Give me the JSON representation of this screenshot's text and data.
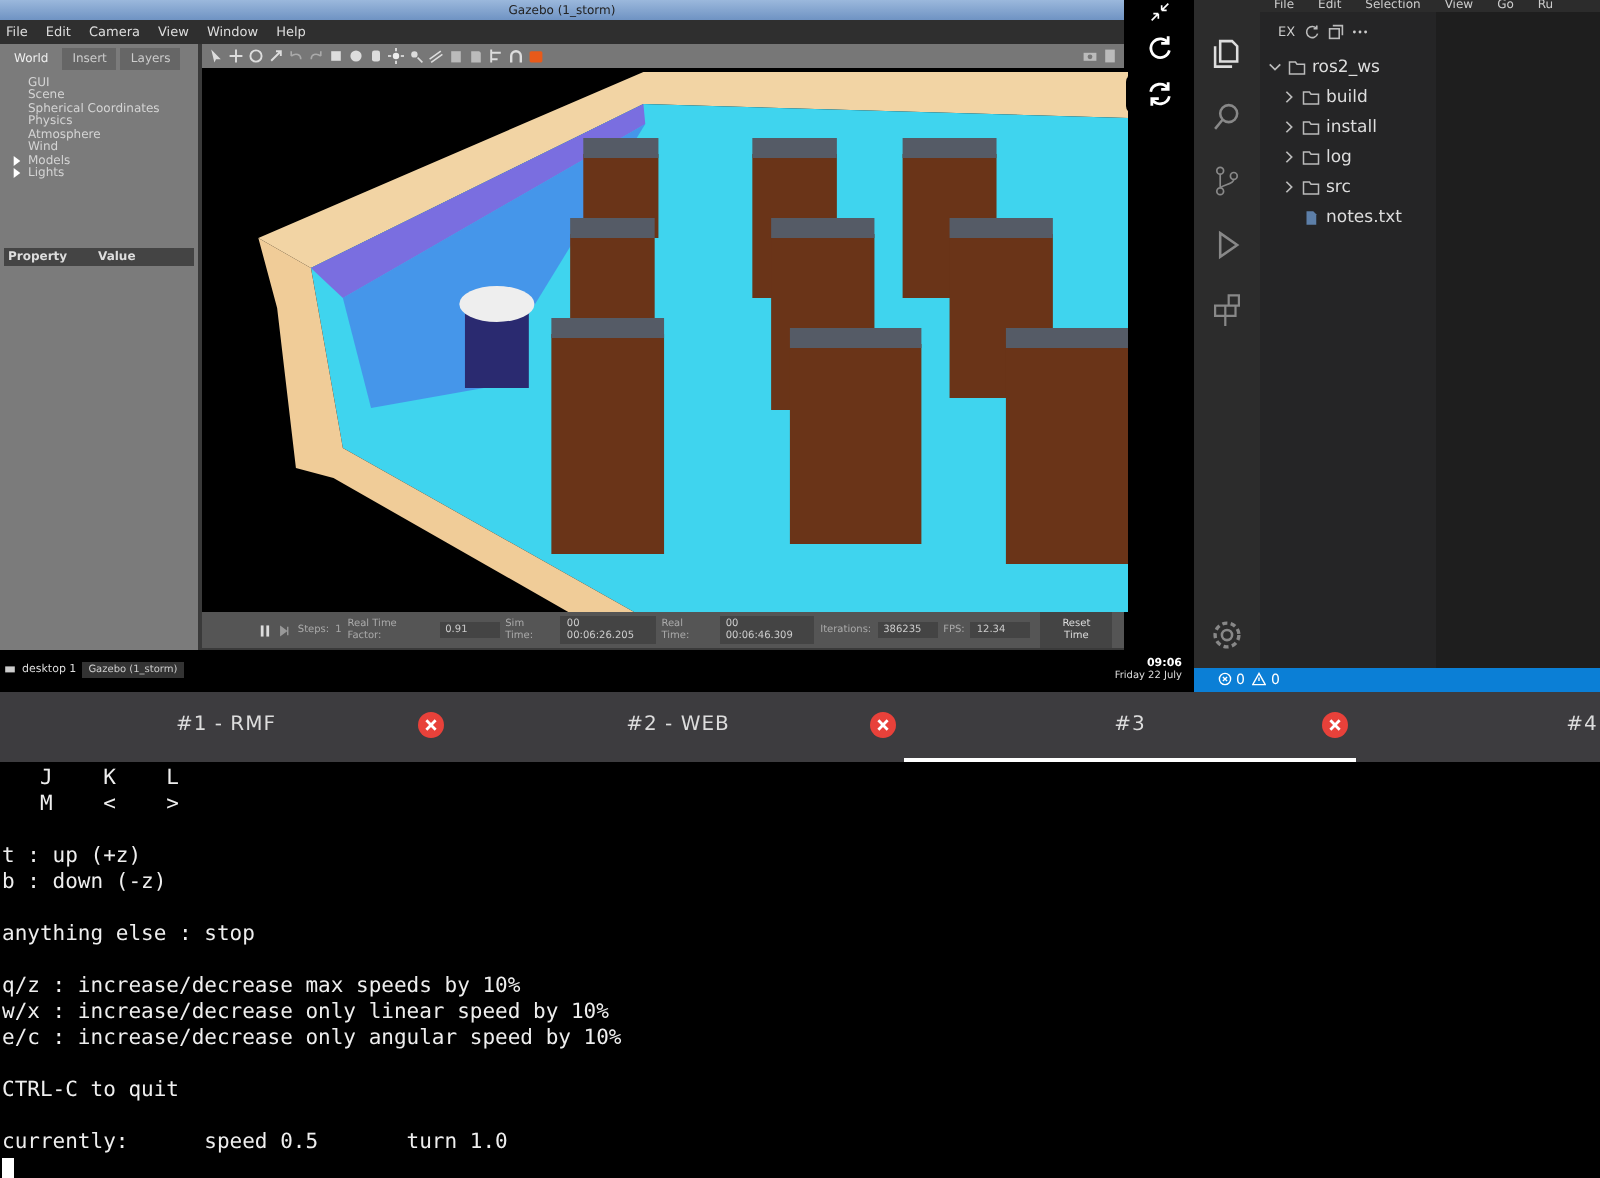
{
  "gazebo": {
    "title": "Gazebo (1_storm)",
    "menu": [
      "File",
      "Edit",
      "Camera",
      "View",
      "Window",
      "Help"
    ],
    "side_tabs": [
      {
        "label": "World",
        "selected": true
      },
      {
        "label": "Insert",
        "selected": false
      },
      {
        "label": "Layers",
        "selected": false
      }
    ],
    "world_items": [
      {
        "label": "GUI",
        "kind": "leaf"
      },
      {
        "label": "Scene",
        "kind": "leaf"
      },
      {
        "label": "Spherical Coordinates",
        "kind": "leaf"
      },
      {
        "label": "Physics",
        "kind": "leaf"
      },
      {
        "label": "Atmosphere",
        "kind": "leaf"
      },
      {
        "label": "Wind",
        "kind": "leaf"
      },
      {
        "label": "Models",
        "kind": "group",
        "expanded": false
      },
      {
        "label": "Lights",
        "kind": "group",
        "expanded": false
      }
    ],
    "property_header": [
      "Property",
      "Value"
    ],
    "bottom_bar": {
      "steps_label": "Steps:",
      "steps": "1",
      "fields": [
        {
          "label": "Real Time Factor:",
          "value": "0.91"
        },
        {
          "label": "Sim Time:",
          "value": "00 00:06:26.205"
        },
        {
          "label": "Real Time:",
          "value": "00 00:06:46.309"
        },
        {
          "label": "Iterations:",
          "value": "386235"
        },
        {
          "label": "FPS:",
          "value": "12.34"
        }
      ],
      "reset_button": "Reset Time"
    }
  },
  "taskbar": {
    "desktop": "desktop 1",
    "window": "Gazebo (1_storm)",
    "time": "09:06",
    "date": "Friday 22 July"
  },
  "vscode": {
    "menu": [
      "File",
      "Edit",
      "Selection",
      "View",
      "Go",
      "Ru"
    ],
    "explorer_title": "EX",
    "tree": [
      {
        "label": "ros2_ws",
        "kind": "folder",
        "expanded": true,
        "children": [
          {
            "label": "build",
            "kind": "folder",
            "expanded": false
          },
          {
            "label": "install",
            "kind": "folder",
            "expanded": false
          },
          {
            "label": "log",
            "kind": "folder",
            "expanded": false
          },
          {
            "label": "src",
            "kind": "folder",
            "expanded": false
          },
          {
            "label": "notes.txt",
            "kind": "file"
          }
        ]
      }
    ],
    "status": {
      "errors": "0",
      "warnings": "0"
    }
  },
  "terminal_tabs": [
    {
      "label": "#1 - RMF",
      "selected": false,
      "closable": true
    },
    {
      "label": "#2 - WEB",
      "selected": false,
      "closable": true
    },
    {
      "label": "#3",
      "selected": true,
      "closable": true
    },
    {
      "label": "#4",
      "selected": false,
      "closable": false
    }
  ],
  "terminal_groups": [
    [
      "   J    K    L",
      "   M    <    >"
    ],
    [
      "t : up (+z)",
      "b : down (-z)"
    ],
    [
      "anything else : stop"
    ],
    [
      "q/z : increase/decrease max speeds by 10%",
      "w/x : increase/decrease only linear speed by 10%",
      "e/c : increase/decrease only angular speed by 10%"
    ],
    [
      "CTRL-C to quit"
    ],
    [
      "currently:      speed 0.5       turn 1.0"
    ]
  ]
}
